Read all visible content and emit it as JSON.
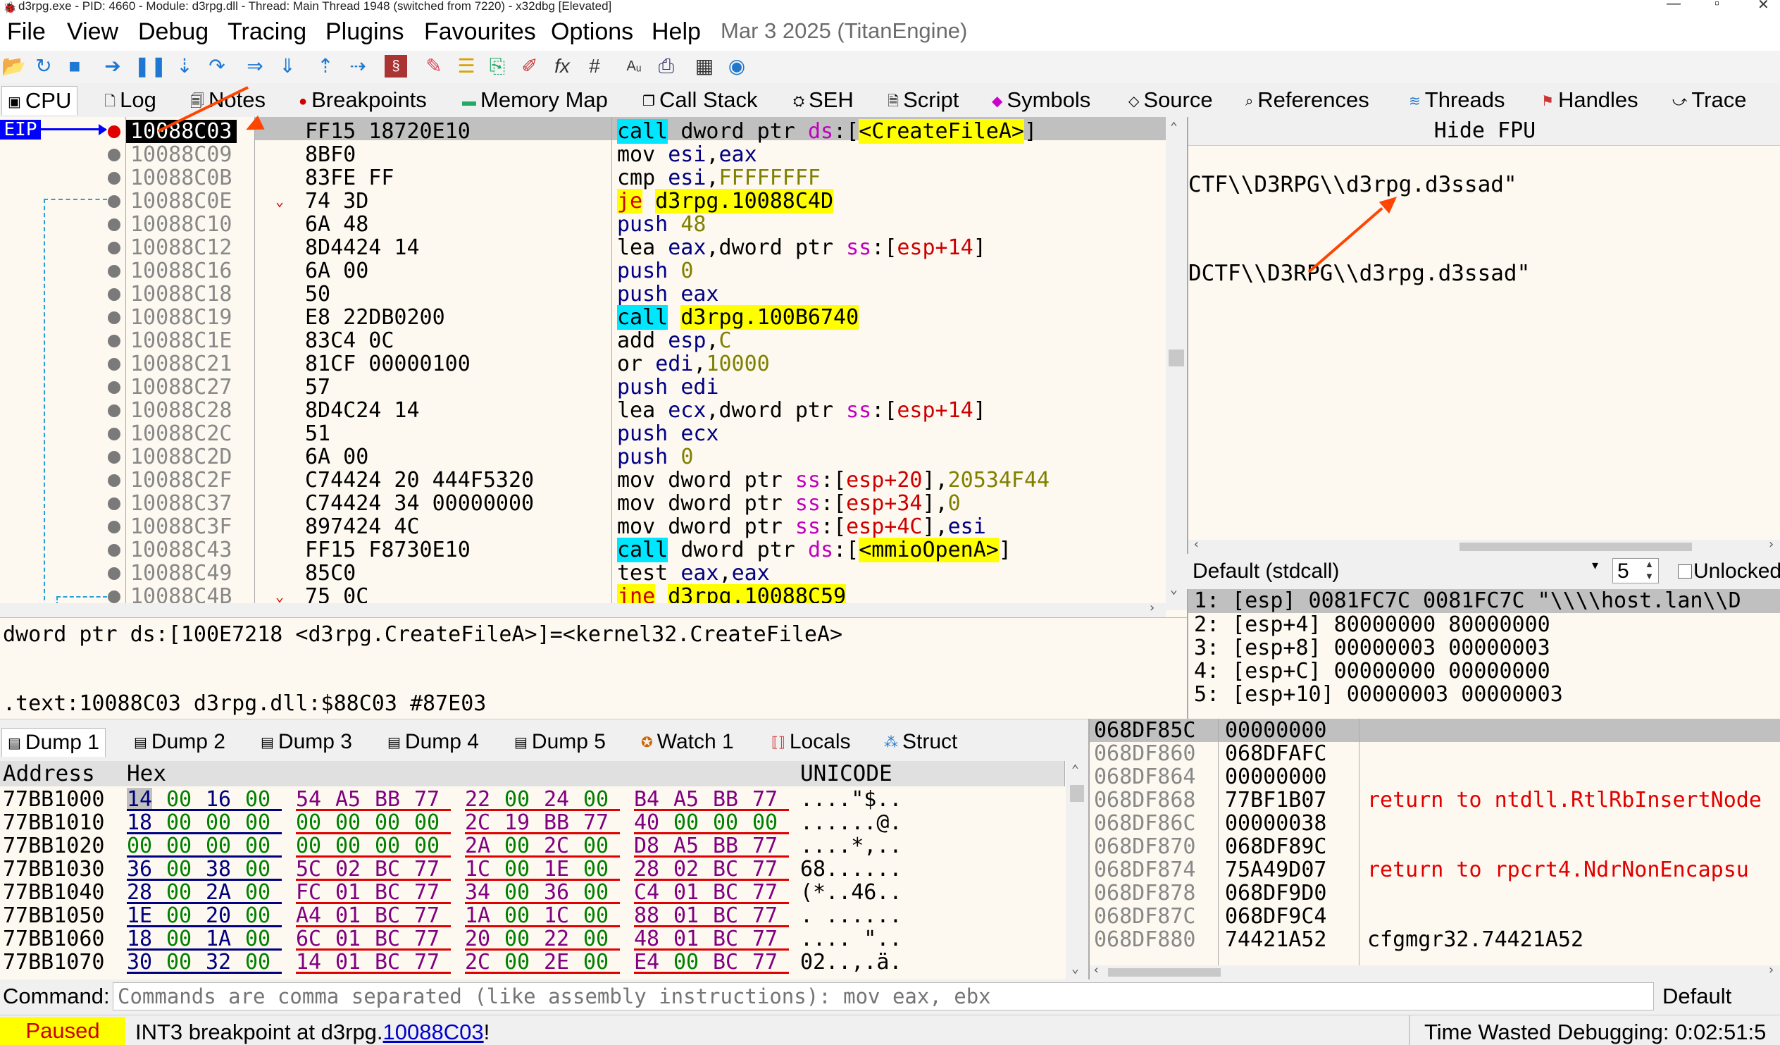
{
  "window": {
    "title": "d3rpg.exe - PID: 4660 - Module: d3rpg.dll - Thread: Main Thread 1948 (switched from 7220) - x32dbg [Elevated]"
  },
  "menu": {
    "items": [
      "File",
      "View",
      "Debug",
      "Tracing",
      "Plugins",
      "Favourites",
      "Options",
      "Help"
    ],
    "date": "Mar 3 2025 (TitanEngine)"
  },
  "tabs": [
    "CPU",
    "Log",
    "Notes",
    "Breakpoints",
    "Memory Map",
    "Call Stack",
    "SEH",
    "Script",
    "Symbols",
    "Source",
    "References",
    "Threads",
    "Handles",
    "Trace"
  ],
  "eip_label": "EIP",
  "disasm": [
    {
      "addr": "10088C03",
      "bytes": "FF15 18720E10",
      "mn": "call",
      "ops": [
        [
          "dword ptr ",
          "kw"
        ],
        [
          "ds",
          "seg"
        ],
        [
          ":[",
          ""
        ],
        [
          "<CreateFileA>",
          "sym"
        ],
        [
          "]",
          ""
        ]
      ]
    },
    {
      "addr": "10088C09",
      "bytes": "8BF0",
      "mn": "mov",
      "ops": [
        [
          "esi",
          "reg2"
        ],
        [
          ",",
          ""
        ],
        [
          "eax",
          "reg2"
        ]
      ]
    },
    {
      "addr": "10088C0B",
      "bytes": "83FE FF",
      "mn": "cmp",
      "ops": [
        [
          "esi",
          "reg2"
        ],
        [
          ",",
          ""
        ],
        [
          "FFFFFFFF",
          "num"
        ]
      ]
    },
    {
      "addr": "10088C0E",
      "bytes": "74 3D",
      "mn": "je",
      "ops": [
        [
          "d3rpg.10088C4D",
          "sym"
        ]
      ]
    },
    {
      "addr": "10088C10",
      "bytes": "6A 48",
      "mn": "push",
      "ops": [
        [
          "48",
          "num"
        ]
      ]
    },
    {
      "addr": "10088C12",
      "bytes": "8D4424 14",
      "mn": "lea",
      "ops": [
        [
          "eax",
          "reg2"
        ],
        [
          ",dword ptr ",
          ""
        ],
        [
          "ss",
          "seg"
        ],
        [
          ":",
          ""
        ],
        [
          "[",
          ""
        ],
        [
          "esp+14",
          "brkv"
        ],
        [
          "]",
          ""
        ]
      ]
    },
    {
      "addr": "10088C16",
      "bytes": "6A 00",
      "mn": "push",
      "ops": [
        [
          "0",
          "num"
        ]
      ]
    },
    {
      "addr": "10088C18",
      "bytes": "50",
      "mn": "push",
      "ops": [
        [
          "eax",
          "reg2"
        ]
      ]
    },
    {
      "addr": "10088C19",
      "bytes": "E8 22DB0200",
      "mn": "call",
      "ops": [
        [
          "d3rpg.100B6740",
          "sym"
        ]
      ]
    },
    {
      "addr": "10088C1E",
      "bytes": "83C4 0C",
      "mn": "add",
      "ops": [
        [
          "esp",
          "reg2"
        ],
        [
          ",",
          ""
        ],
        [
          "C",
          "num"
        ]
      ]
    },
    {
      "addr": "10088C21",
      "bytes": "81CF 00000100",
      "mn": "or",
      "ops": [
        [
          "edi",
          "reg2"
        ],
        [
          ",",
          ""
        ],
        [
          "10000",
          "num"
        ]
      ]
    },
    {
      "addr": "10088C27",
      "bytes": "57",
      "mn": "push",
      "ops": [
        [
          "edi",
          "reg2"
        ]
      ]
    },
    {
      "addr": "10088C28",
      "bytes": "8D4C24 14",
      "mn": "lea",
      "ops": [
        [
          "ecx",
          "reg2"
        ],
        [
          ",dword ptr ",
          ""
        ],
        [
          "ss",
          "seg"
        ],
        [
          ":",
          ""
        ],
        [
          "[",
          ""
        ],
        [
          "esp+14",
          "brkv"
        ],
        [
          "]",
          ""
        ]
      ]
    },
    {
      "addr": "10088C2C",
      "bytes": "51",
      "mn": "push",
      "ops": [
        [
          "ecx",
          "reg2"
        ]
      ]
    },
    {
      "addr": "10088C2D",
      "bytes": "6A 00",
      "mn": "push",
      "ops": [
        [
          "0",
          "num"
        ]
      ]
    },
    {
      "addr": "10088C2F",
      "bytes": "C74424 20 444F5320",
      "mn": "mov",
      "ops": [
        [
          "dword ptr ",
          ""
        ],
        [
          "ss",
          "seg"
        ],
        [
          ":",
          ""
        ],
        [
          "[",
          ""
        ],
        [
          "esp+20",
          "brkv"
        ],
        [
          "]",
          ""
        ],
        [
          ",",
          ""
        ],
        [
          "20534F44",
          "num"
        ]
      ]
    },
    {
      "addr": "10088C37",
      "bytes": "C74424 34 00000000",
      "mn": "mov",
      "ops": [
        [
          "dword ptr ",
          ""
        ],
        [
          "ss",
          "seg"
        ],
        [
          ":",
          ""
        ],
        [
          "[",
          ""
        ],
        [
          "esp+34",
          "brkv"
        ],
        [
          "]",
          ""
        ],
        [
          ",",
          ""
        ],
        [
          "0",
          "num"
        ]
      ]
    },
    {
      "addr": "10088C3F",
      "bytes": "897424 4C",
      "mn": "mov",
      "ops": [
        [
          "dword ptr ",
          ""
        ],
        [
          "ss",
          "seg"
        ],
        [
          ":",
          ""
        ],
        [
          "[",
          ""
        ],
        [
          "esp+4C",
          "brkv"
        ],
        [
          "]",
          ""
        ],
        [
          ",",
          ""
        ],
        [
          "esi",
          "reg2"
        ]
      ]
    },
    {
      "addr": "10088C43",
      "bytes": "FF15 F8730E10",
      "mn": "call",
      "ops": [
        [
          "dword ptr ",
          ""
        ],
        [
          "ds",
          "seg"
        ],
        [
          ":[",
          ""
        ],
        [
          "<mmioOpenA>",
          "sym"
        ],
        [
          "]",
          ""
        ]
      ]
    },
    {
      "addr": "10088C49",
      "bytes": "85C0",
      "mn": "test",
      "ops": [
        [
          "eax",
          "reg2"
        ],
        [
          ",",
          ""
        ],
        [
          "eax",
          "reg2"
        ]
      ]
    },
    {
      "addr": "10088C4B",
      "bytes": "75 0C",
      "mn": "jne",
      "ops": [
        [
          "d3rpg.10088C59",
          "sym"
        ]
      ]
    }
  ],
  "info": {
    "line1": "dword ptr ds:[100E7218 <d3rpg.CreateFileA>]=<kernel32.CreateFileA>",
    "line2": ".text:10088C03 d3rpg.dll:$88C03 #87E03"
  },
  "fpu": {
    "hide_label": "Hide FPU",
    "str1": "CTF\\\\D3RPG\\\\d3rpg.d3ssad\"",
    "str2": "DCTF\\\\D3RPG\\\\d3rpg.d3ssad\""
  },
  "callconv": {
    "value": "Default (stdcall)",
    "count": "5",
    "unlocked": "Unlocked"
  },
  "args": [
    "1: [esp] 0081FC7C 0081FC7C \"\\\\\\\\host.lan\\\\D",
    "2: [esp+4] 80000000 80000000",
    "3: [esp+8] 00000003 00000003",
    "4: [esp+C] 00000000 00000000",
    "5: [esp+10] 00000003 00000003"
  ],
  "dumptabs": [
    "Dump 1",
    "Dump 2",
    "Dump 3",
    "Dump 4",
    "Dump 5",
    "Watch 1",
    "Locals",
    "Struct"
  ],
  "dump": {
    "headers": [
      "Address",
      "Hex",
      "UNICODE"
    ],
    "rows": [
      {
        "addr": "77BB1000",
        "hex": [
          "14",
          "00",
          "16",
          "00",
          "54",
          "A5",
          "BB",
          "77",
          "22",
          "00",
          "24",
          "00",
          "B4",
          "A5",
          "BB",
          "77"
        ],
        "uni": "....\"$.."
      },
      {
        "addr": "77BB1010",
        "hex": [
          "18",
          "00",
          "00",
          "00",
          "00",
          "00",
          "00",
          "00",
          "2C",
          "19",
          "BB",
          "77",
          "40",
          "00",
          "00",
          "00"
        ],
        "uni": "......@."
      },
      {
        "addr": "77BB1020",
        "hex": [
          "00",
          "00",
          "00",
          "00",
          "00",
          "00",
          "00",
          "00",
          "2A",
          "00",
          "2C",
          "00",
          "D8",
          "A5",
          "BB",
          "77"
        ],
        "uni": "....*,.."
      },
      {
        "addr": "77BB1030",
        "hex": [
          "36",
          "00",
          "38",
          "00",
          "5C",
          "02",
          "BC",
          "77",
          "1C",
          "00",
          "1E",
          "00",
          "28",
          "02",
          "BC",
          "77"
        ],
        "uni": "68......"
      },
      {
        "addr": "77BB1040",
        "hex": [
          "28",
          "00",
          "2A",
          "00",
          "FC",
          "01",
          "BC",
          "77",
          "34",
          "00",
          "36",
          "00",
          "C4",
          "01",
          "BC",
          "77"
        ],
        "uni": "(*..46.."
      },
      {
        "addr": "77BB1050",
        "hex": [
          "1E",
          "00",
          "20",
          "00",
          "A4",
          "01",
          "BC",
          "77",
          "1A",
          "00",
          "1C",
          "00",
          "88",
          "01",
          "BC",
          "77"
        ],
        "uni": ". ......"
      },
      {
        "addr": "77BB1060",
        "hex": [
          "18",
          "00",
          "1A",
          "00",
          "6C",
          "01",
          "BC",
          "77",
          "20",
          "00",
          "22",
          "00",
          "48",
          "01",
          "BC",
          "77"
        ],
        "uni": ".... \".."
      },
      {
        "addr": "77BB1070",
        "hex": [
          "30",
          "00",
          "32",
          "00",
          "14",
          "01",
          "BC",
          "77",
          "2C",
          "00",
          "2E",
          "00",
          "E4",
          "00",
          "BC",
          "77"
        ],
        "uni": "02..,.ä."
      }
    ]
  },
  "stack": [
    {
      "addr": "068DF85C",
      "val": "00000000",
      "cmt": ""
    },
    {
      "addr": "068DF860",
      "val": "068DFAFC",
      "cmt": ""
    },
    {
      "addr": "068DF864",
      "val": "00000000",
      "cmt": ""
    },
    {
      "addr": "068DF868",
      "val": "77BF1B07",
      "cmt": "return to ntdll.RtlRbInsertNode"
    },
    {
      "addr": "068DF86C",
      "val": "00000038",
      "cmt": ""
    },
    {
      "addr": "068DF870",
      "val": "068DF89C",
      "cmt": ""
    },
    {
      "addr": "068DF874",
      "val": "75A49D07",
      "cmt": "return to rpcrt4.NdrNonEncapsu"
    },
    {
      "addr": "068DF878",
      "val": "068DF9D0",
      "cmt": ""
    },
    {
      "addr": "068DF87C",
      "val": "068DF9C4",
      "cmt": ""
    },
    {
      "addr": "068DF880",
      "val": "74421A52",
      "cmt": "cfgmgr32.74421A52"
    }
  ],
  "command": {
    "label": "Command:",
    "placeholder": "Commands are comma separated (like assembly instructions): mov eax, ebx",
    "default": "Default"
  },
  "status": {
    "state": "Paused",
    "msg_prefix": "INT3 breakpoint at d3rpg.",
    "msg_link": "10088C03",
    "msg_suffix": "!",
    "time": "Time Wasted Debugging: 0:02:51:5"
  },
  "colors": {
    "accent_arrow": "#ff4500",
    "paused_bg": "#ffff00",
    "call_highlight": "#00e6ff",
    "symbol_highlight": "#ffff00"
  }
}
